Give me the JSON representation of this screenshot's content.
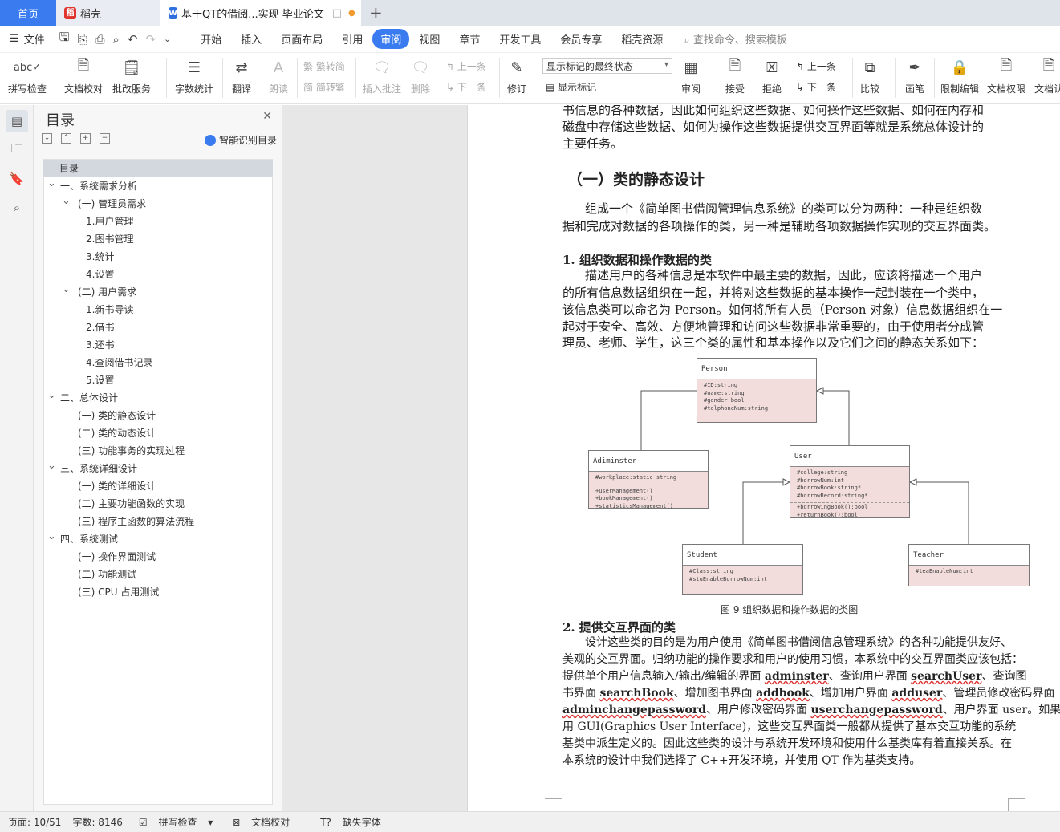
{
  "tabs": {
    "home": "首页",
    "daoke": "稻壳",
    "doc": "基于QT的借阅...实现 毕业论文"
  },
  "menubar": {
    "file": "文件",
    "menus": [
      "开始",
      "插入",
      "页面布局",
      "引用",
      "审阅",
      "视图",
      "章节",
      "开发工具",
      "会员专享",
      "稻壳资源"
    ],
    "active_menu": "审阅",
    "search": "查找命令、搜索模板"
  },
  "ribbon": {
    "spell": "拼写检查",
    "proof": "文档校对",
    "annotate": "批改服务",
    "wordcount": "字数统计",
    "translate": "翻译",
    "read": "朗读",
    "trad": "繁转简",
    "simp": "简转繁",
    "insert_comment": "插入批注",
    "delete": "删除",
    "prev": "上一条",
    "next": "下一条",
    "revise": "修订",
    "display_select": "显示标记的最终状态",
    "show_marks": "显示标记",
    "review": "审阅",
    "accept": "接受",
    "reject": "拒绝",
    "prev2": "上一条",
    "next2": "下一条",
    "compare": "比较",
    "pen": "画笔",
    "restrict": "限制编辑",
    "permission": "文档权限",
    "doc_auth": "文档认"
  },
  "toc": {
    "title": "目录",
    "smart": "智能识别目录",
    "items": [
      {
        "t": "目录",
        "lvl": 0,
        "sel": true
      },
      {
        "t": "一、系统需求分析",
        "lvl": 1,
        "car": true
      },
      {
        "t": "(一) 管理员需求",
        "lvl": 2,
        "car": true
      },
      {
        "t": "1.用户管理",
        "lvl": 3
      },
      {
        "t": "2.图书管理",
        "lvl": 3
      },
      {
        "t": "3.统计",
        "lvl": 3
      },
      {
        "t": "4.设置",
        "lvl": 3
      },
      {
        "t": "(二) 用户需求",
        "lvl": 2,
        "car": true
      },
      {
        "t": "1.新书导读",
        "lvl": 3
      },
      {
        "t": "2.借书",
        "lvl": 3
      },
      {
        "t": "3.还书",
        "lvl": 3
      },
      {
        "t": "4.查阅借书记录",
        "lvl": 3
      },
      {
        "t": "5.设置",
        "lvl": 3
      },
      {
        "t": "二、总体设计",
        "lvl": 1,
        "car": true
      },
      {
        "t": "(一) 类的静态设计",
        "lvl": 2
      },
      {
        "t": "(二) 类的动态设计",
        "lvl": 2
      },
      {
        "t": "(三) 功能事务的实现过程",
        "lvl": 2
      },
      {
        "t": "三、系统详细设计",
        "lvl": 1,
        "car": true
      },
      {
        "t": "(一) 类的详细设计",
        "lvl": 2
      },
      {
        "t": "(二) 主要功能函数的实现",
        "lvl": 2
      },
      {
        "t": "(三) 程序主函数的算法流程",
        "lvl": 2
      },
      {
        "t": "四、系统测试",
        "lvl": 1,
        "car": true
      },
      {
        "t": "(一) 操作界面测试",
        "lvl": 2
      },
      {
        "t": "(二) 功能测试",
        "lvl": 2
      },
      {
        "t": "(三) CPU 占用测试",
        "lvl": 2
      }
    ]
  },
  "doc": {
    "intro": [
      "书信息的各种数据，因此如何组织这些数据、如何操作这些数据、如何在内存和",
      "磁盘中存储这些数据、如何为操作这些数据提供交互界面等就是系统总体设计的",
      "主要任务。"
    ],
    "h1": "（一）类的静态设计",
    "p1": [
      "组成一个《简单图书借阅管理信息系统》的类可以分为两种：一种是组织数",
      "据和完成对数据的各项操作的类，另一种是辅助各项数据操作实现的交互界面类。"
    ],
    "h2a": "1.  组织数据和操作数据的类",
    "p2": [
      "描述用户的各种信息是本软件中最主要的数据，因此，应该将描述一个用户",
      "的所有信息数据组织在一起，并将对这些数据的基本操作一起封装在一个类中，",
      "该信息类可以命名为 Person。如何将所有人员（Person 对象）信息数据组织在一",
      "起对于安全、高效、方便地管理和访问这些数据非常重要的，由于使用者分成管",
      "理员、老师、学生，这三个类的属性和基本操作以及它们之间的静态关系如下："
    ],
    "caption": "图 9  组织数据和操作数据的类图",
    "h2b": "2.  提供交互界面的类",
    "p3_1": "设计这些类的目的是为用户使用《简单图书借阅信息管理系统》的各种功能提供友好、",
    "p3_2": "美观的交互界面。归纳功能的操作要求和用户的使用习惯，本系统中的交互界面类应该包括：",
    "p3_3a": "提供单个用户信息输入/输出/编辑的界面 ",
    "p3_3b": "adminster",
    "p3_3c": "、查询用户界面 ",
    "p3_3d": "searchUser",
    "p3_3e": "、查询图",
    "p3_4a": "书界面 ",
    "p3_4b": "searchBook",
    "p3_4c": "、增加图书界面 ",
    "p3_4d": "addbook",
    "p3_4e": "、增加用户界面 ",
    "p3_4f": "adduser",
    "p3_4g": "、管理员修改密码界面",
    "p3_5a": "adminchangepassword",
    "p3_5b": "、用户修改密码界面 ",
    "p3_5c": "userchangepassword",
    "p3_5d": "、用户界面 user。如果使",
    "p3_6": "用 GUI(Graphics User Interface)，这些交互界面类一般都从提供了基本交互功能的系统",
    "p3_7": "基类中派生定义的。因此这些类的设计与系统开发环境和使用什么基类库有着直接关系。在",
    "p3_8": "本系统的设计中我们选择了 C++开发环境，并使用 QT 作为基类支持。"
  },
  "uml": {
    "person": {
      "name": "Person",
      "fields": [
        "#ID:string",
        "#name:string",
        "#gender:bool",
        "#telphoneNum:string"
      ]
    },
    "admin": {
      "name": "Adiminster",
      "fields": [
        "#workplace:static string"
      ],
      "methods": [
        "+userManagement()",
        "+bookManagement()",
        "+statisticsManagement()"
      ]
    },
    "user": {
      "name": "User",
      "fields": [
        "#college:string",
        "#borrowNum:int",
        "#borrowBook:string*",
        "#borrowRecord:string*"
      ],
      "methods": [
        "+borrowingBook():bool",
        "+returnBook():bool"
      ]
    },
    "student": {
      "name": "Student",
      "fields": [
        "#Class:string",
        "#stuEnableBorrowNum:int"
      ]
    },
    "teacher": {
      "name": "Teacher",
      "fields": [
        "#teaEnableNum:int"
      ]
    }
  },
  "status": {
    "page": "页面: 10/51",
    "words": "字数: 8146",
    "spell": "拼写检查",
    "proof": "文档校对",
    "font": "缺失字体"
  }
}
